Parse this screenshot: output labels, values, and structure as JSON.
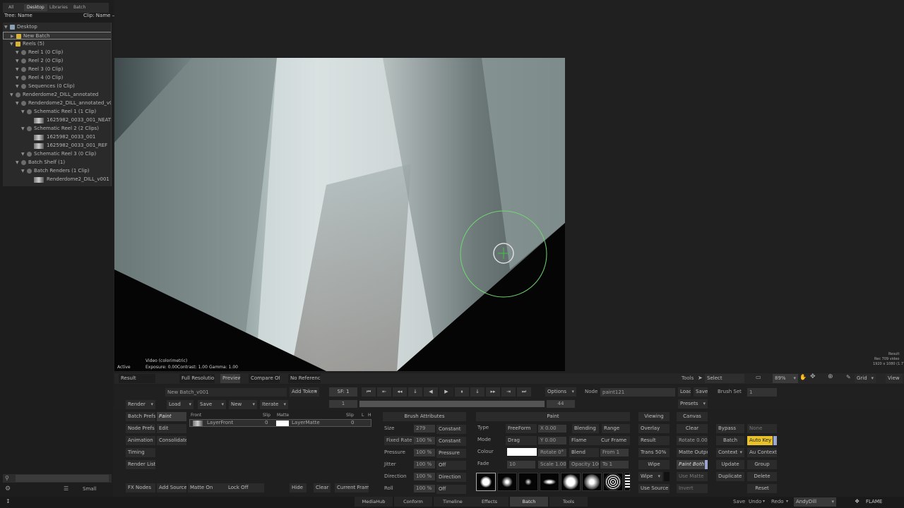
{
  "library": {
    "tabs": [
      "All",
      "Desktop",
      "Libraries",
      "Batch"
    ],
    "tree_header": "Tree: Name",
    "clip_header": "Clip: Name —",
    "items": [
      {
        "label": "Desktop",
        "indent": 0,
        "icon": "desktop-icon"
      },
      {
        "label": "New Batch",
        "indent": 1,
        "icon": "batch-icon"
      },
      {
        "label": "Reels (5)",
        "indent": 1,
        "icon": "reel-group-icon"
      },
      {
        "label": "Reel 1 (0 Clip)",
        "indent": 2,
        "icon": "reel-icon"
      },
      {
        "label": "Reel 2 (0 Clip)",
        "indent": 2,
        "icon": "reel-icon"
      },
      {
        "label": "Reel 3 (0 Clip)",
        "indent": 2,
        "icon": "reel-icon"
      },
      {
        "label": "Reel 4 (0 Clip)",
        "indent": 2,
        "icon": "reel-icon"
      },
      {
        "label": "Sequences (0 Clip)",
        "indent": 2,
        "icon": "sequence-icon"
      },
      {
        "label": "Renderdome2_DILL_annotated",
        "indent": 1,
        "icon": "library-icon"
      },
      {
        "label": "Renderdome2_DILL_annotated_v001 (3)",
        "indent": 2,
        "icon": "reel-icon"
      },
      {
        "label": "Schematic Reel 1 (1 Clip)",
        "indent": 3,
        "icon": "reel-icon"
      },
      {
        "label": "1625982_0033_001_NEAT",
        "indent": 5,
        "icon": "clip-thumb"
      },
      {
        "label": "Schematic Reel 2 (2 Clips)",
        "indent": 3,
        "icon": "reel-icon"
      },
      {
        "label": "1625982_0033_001",
        "indent": 5,
        "icon": "clip-thumb"
      },
      {
        "label": "1625982_0033_001_REF",
        "indent": 5,
        "icon": "clip-thumb"
      },
      {
        "label": "Schematic Reel 3 (0 Clip)",
        "indent": 3,
        "icon": "reel-icon"
      },
      {
        "label": "Batch Shelf (1)",
        "indent": 2,
        "icon": "reel-icon"
      },
      {
        "label": "Batch Renders (1 Clip)",
        "indent": 3,
        "icon": "reel-icon"
      },
      {
        "label": "Renderdome2_DILL_v001",
        "indent": 5,
        "icon": "clip-thumb"
      }
    ],
    "size": "Small"
  },
  "viewer": {
    "mode": "Active",
    "info": "Video (colorimetric)",
    "exposure": "Exposure: 0.00",
    "contrast": "Contrast: 1.00",
    "gamma": "Gamma: 1.00",
    "result": "Result",
    "res1": "Rec 709 video",
    "res2": "1920 x 1080 (1.778)"
  },
  "toolbar": {
    "view": "Result",
    "full_res": "Full Resolution",
    "preview": "Preview",
    "compare": "Compare Off",
    "reference": "No Reference",
    "tools": "Tools",
    "select": "Select",
    "zoom": "89%",
    "grid": "Grid",
    "view_btn": "View"
  },
  "transport": {
    "batch_name": "New Batch_v001",
    "add_token": "Add Token",
    "frame_sf": "SF: 1",
    "start": "1",
    "end": "44",
    "options": "Options",
    "node_label": "Node",
    "node_name": "paint121",
    "load": "Load",
    "save": "Save",
    "brush_set_label": "Brush Set",
    "brush_set": "1",
    "presets": "Presets"
  },
  "left_buttons": {
    "render": "Render",
    "load": "Load",
    "save": "Save",
    "new": "New",
    "iterate": "Iterate",
    "batch_prefs": "Batch Prefs",
    "paint": "Paint",
    "node_prefs": "Node Prefs",
    "edit": "Edit",
    "animation": "Animation",
    "consolidate": "Consolidate",
    "timing": "Timing",
    "render_list": "Render List",
    "fx_nodes": "FX Nodes",
    "add_source": "Add Source",
    "matte_on": "Matte On",
    "lock_off": "Lock Off",
    "hide": "Hide",
    "clear": "Clear",
    "current_frame": "Current Frame"
  },
  "layers": {
    "front_header": "Front",
    "slip_header": "Slip",
    "matte_header": "Matte",
    "slip2_header": "Slip",
    "l_header": "L",
    "h_header": "H",
    "front": "LayerFront",
    "front_slip": "0",
    "matte": "LayerMatte",
    "matte_slip": "0"
  },
  "brush_attr": {
    "title": "Brush Attributes",
    "rows": [
      {
        "label": "Size",
        "value": "279",
        "mode": "Constant"
      },
      {
        "label": "Fixed Rate",
        "value": "100 %",
        "mode": "Constant"
      },
      {
        "label": "Pressure",
        "value": "100 %",
        "mode": "Pressure"
      },
      {
        "label": "Jitter",
        "value": "100 %",
        "mode": "Off"
      },
      {
        "label": "Direction",
        "value": "100 %",
        "mode": "Direction"
      },
      {
        "label": "Roll",
        "value": "100 %",
        "mode": "Off"
      }
    ]
  },
  "paint": {
    "title": "Paint",
    "type_label": "Type",
    "type": "FreeForm",
    "x": "X 0.00",
    "blending": "Blending",
    "range": "Range",
    "mode_label": "Mode",
    "mode": "Drag",
    "y": "Y 0.00",
    "flame": "Flame",
    "cur_frame": "Cur Frame",
    "colour_label": "Colour",
    "rotate": "Rotate 0°",
    "blend": "Blend",
    "from": "From 1",
    "fade_label": "Fade",
    "fade": "10",
    "scale": "Scale 1.00",
    "opacity": "Opacity 100",
    "to": "To 1"
  },
  "right": {
    "viewing": "Viewing",
    "overlay": "Overlay",
    "result": "Result",
    "trans": "Trans 50%",
    "wipe": "Wipe",
    "wipe2": "Wipe",
    "use_source": "Use Source",
    "canvas": "Canvas",
    "clear": "Clear",
    "rotate": "Rotate 0.00",
    "matte_output": "Matte Output",
    "paint_both": "Paint Both",
    "use_matte": "Use Matte",
    "invert": "Invert",
    "bypass": "Bypass",
    "none": "None",
    "batch": "Batch",
    "auto_key": "Auto Key",
    "context": "Context",
    "au_context": "Au Context",
    "update": "Update",
    "group": "Group",
    "duplicate": "Duplicate",
    "delete": "Delete",
    "reset": "Reset"
  },
  "bottom": {
    "tabs": [
      "MediaHub",
      "Conform",
      "Timeline",
      "Effects",
      "Batch",
      "Tools"
    ],
    "active": "Batch",
    "save": "Save",
    "undo": "Undo",
    "redo": "Redo",
    "user": "AndyDill",
    "app": "FLAME"
  },
  "colors": {
    "accent": "#e8c22a",
    "brush_ring": "#6fd86f",
    "active_tab": "#3a3a3a"
  }
}
